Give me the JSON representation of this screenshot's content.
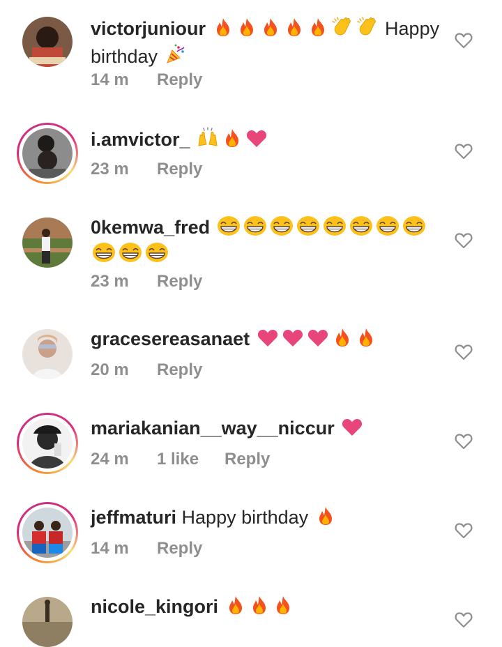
{
  "comments": [
    {
      "username": "victorjuniour",
      "emojis_before": [
        "fire",
        "fire",
        "fire",
        "fire",
        "fire",
        "clap",
        "clap"
      ],
      "text": "Happy",
      "text_line2": "birthday",
      "emojis_after": [
        "party"
      ],
      "time": "14 m",
      "likes": "",
      "reply": "Reply",
      "ring": false
    },
    {
      "username": "i.amvictor_",
      "emojis_before": [
        "raised-hands",
        "fire",
        "heart"
      ],
      "text": "",
      "time": "23 m",
      "likes": "",
      "reply": "Reply",
      "ring": true
    },
    {
      "username": "0kemwa_fred",
      "emojis_before": [
        "grin",
        "grin",
        "grin",
        "grin",
        "grin",
        "grin",
        "grin",
        "grin",
        "grin",
        "grin",
        "grin"
      ],
      "text": "",
      "time": "23 m",
      "likes": "",
      "reply": "Reply",
      "ring": false
    },
    {
      "username": "gracesereasanaet",
      "emojis_before": [
        "heart",
        "heart",
        "heart",
        "fire",
        "fire"
      ],
      "text": "",
      "time": "20 m",
      "likes": "",
      "reply": "Reply",
      "ring": false
    },
    {
      "username": "mariakanian__way__niccur",
      "emojis_before": [
        "heart"
      ],
      "text": "",
      "time": "24 m",
      "likes": "1 like",
      "reply": "Reply",
      "ring": true
    },
    {
      "username": "jeffmaturi",
      "emojis_before": [],
      "text": "Happy birthday",
      "emojis_after": [
        "fire"
      ],
      "time": "14 m",
      "likes": "",
      "reply": "Reply",
      "ring": true
    },
    {
      "username": "nicole_kingori",
      "emojis_before": [
        "fire",
        "fire",
        "fire"
      ],
      "text": "",
      "time": "",
      "likes": "",
      "reply": "",
      "ring": false
    }
  ],
  "colors": {
    "username": "#262626",
    "meta": "#8e8e8e",
    "heart_emoji": "#e8457b",
    "fire_outer": "#f4511e",
    "fire_inner": "#ffb300",
    "grin_face": "#fcc21b"
  },
  "icons": {
    "like": "heart-outline-icon"
  }
}
